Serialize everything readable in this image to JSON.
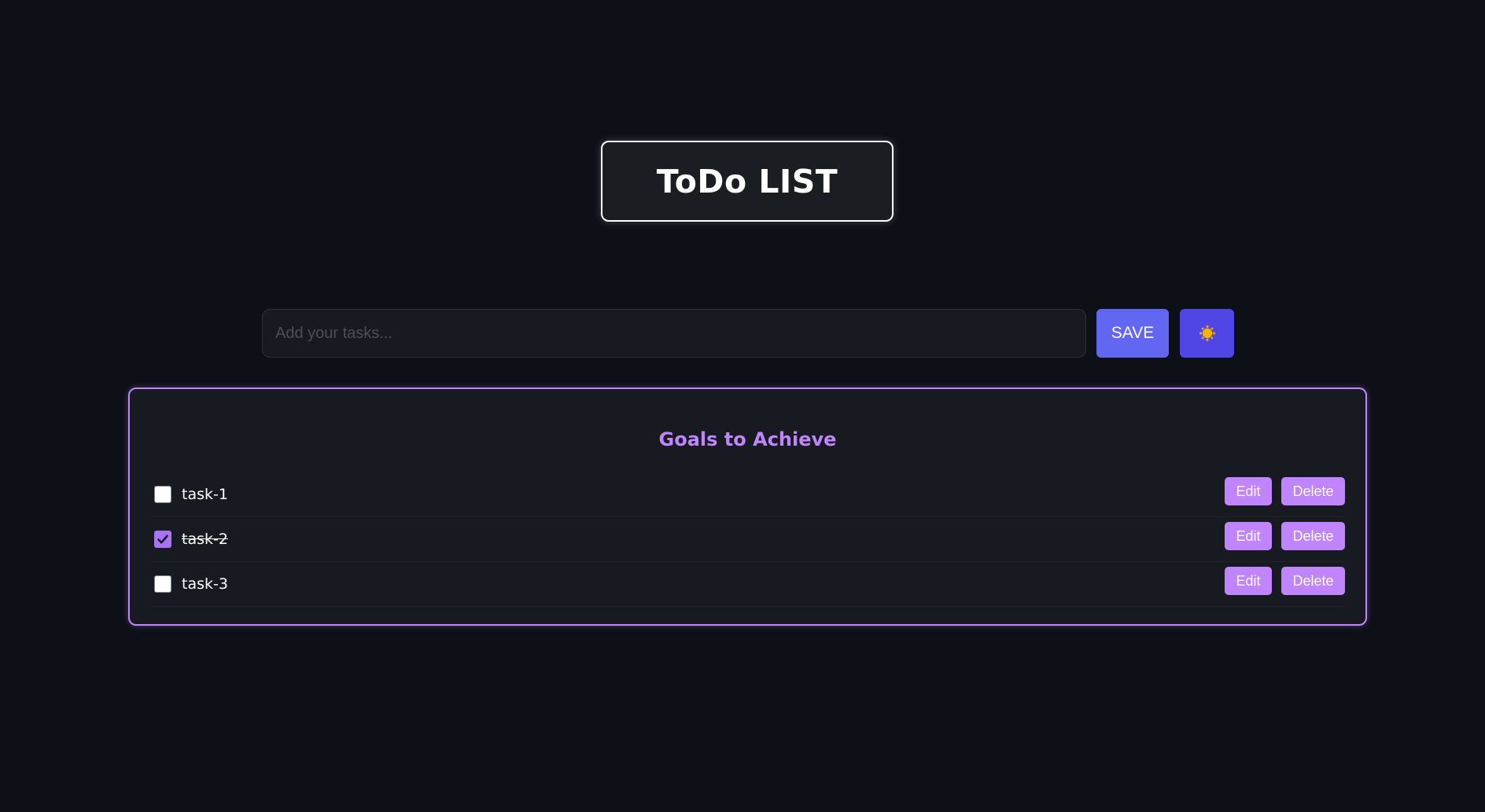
{
  "header": {
    "title": "ToDo LIST"
  },
  "input_bar": {
    "placeholder": "Add your tasks...",
    "value": "",
    "save_label": "SAVE",
    "theme_icon": "sun-icon"
  },
  "goals": {
    "heading": "Goals to Achieve",
    "tasks": [
      {
        "label": "task-1",
        "completed": false,
        "edit_label": "Edit",
        "delete_label": "Delete"
      },
      {
        "label": "task-2",
        "completed": true,
        "edit_label": "Edit",
        "delete_label": "Delete"
      },
      {
        "label": "task-3",
        "completed": false,
        "edit_label": "Edit",
        "delete_label": "Delete"
      }
    ]
  },
  "colors": {
    "background": "#0d1017",
    "panel": "#171a21",
    "accent_purple": "#c084fc",
    "save_button": "#6366f1",
    "theme_button": "#4f46e5",
    "sun": "#f4b400"
  }
}
